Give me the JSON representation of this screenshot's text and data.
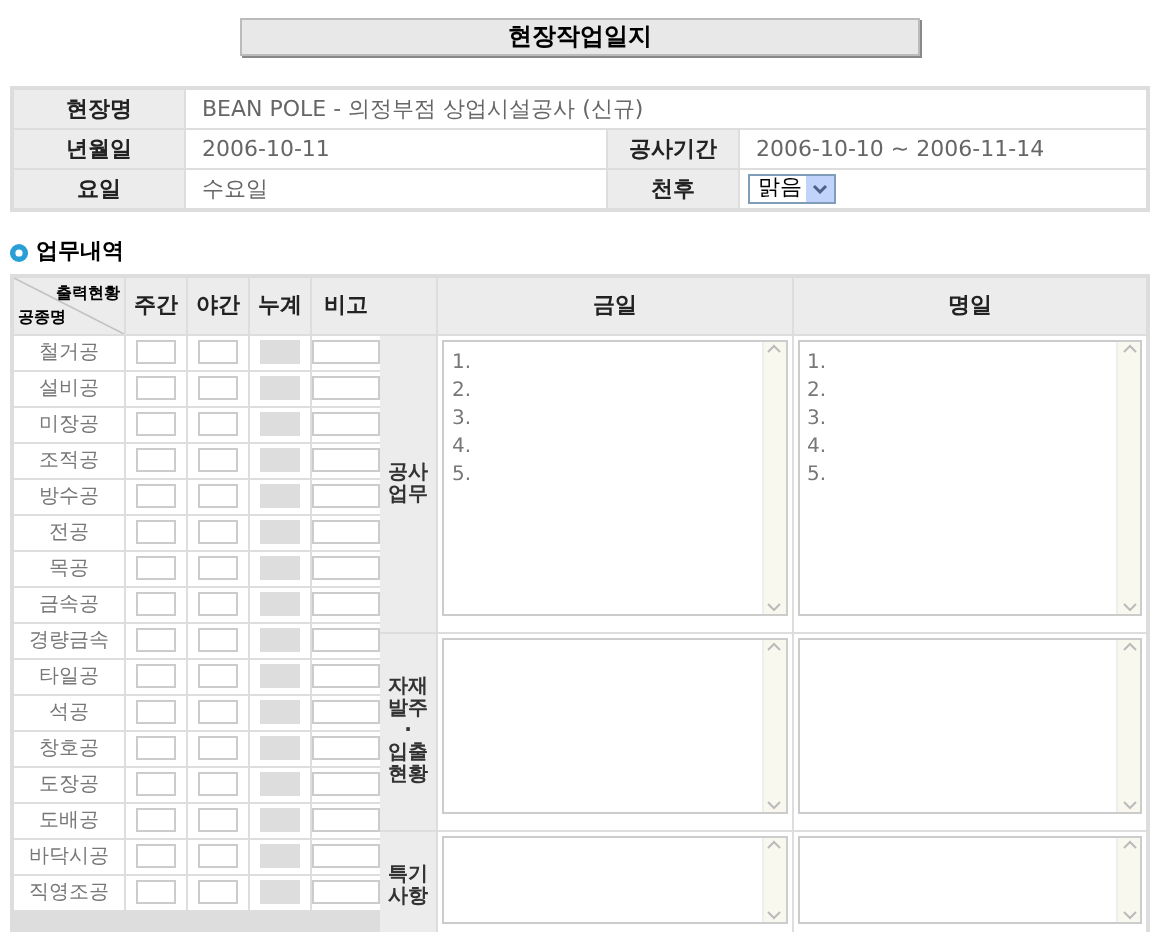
{
  "title": "현장작업일지",
  "info": {
    "site_label": "현장명",
    "site_value": "BEAN POLE - 의정부점 상업시설공사 (신규)",
    "date_label": "년월일",
    "date_value": "2006-10-11",
    "period_label": "공사기간",
    "period_value": "2006-10-10 ~ 2006-11-14",
    "day_label": "요일",
    "day_value": "수요일",
    "weather_label": "천후",
    "weather_value": "맑음"
  },
  "section_title": "업무내역",
  "attendance": {
    "corner_top": "출력현황",
    "corner_bottom": "공종명",
    "columns": [
      "주간",
      "야간",
      "누계",
      "비고"
    ],
    "rows": [
      "철거공",
      "설비공",
      "미장공",
      "조적공",
      "방수공",
      "전공",
      "목공",
      "금속공",
      "경량금속",
      "타일공",
      "석공",
      "창호공",
      "도장공",
      "도배공",
      "바닥시공",
      "직영조공"
    ]
  },
  "work": {
    "columns": [
      "금일",
      "명일"
    ],
    "rows": [
      {
        "label_lines": [
          "공사",
          "업무"
        ],
        "today": "1.\n2.\n3.\n4.\n5.",
        "tomorrow": "1.\n2.\n3.\n4.\n5."
      },
      {
        "label_lines": [
          "자재",
          "발주",
          "·",
          "입출",
          "현황"
        ]
      },
      {
        "label_lines": [
          "특기",
          "사항"
        ]
      }
    ]
  }
}
